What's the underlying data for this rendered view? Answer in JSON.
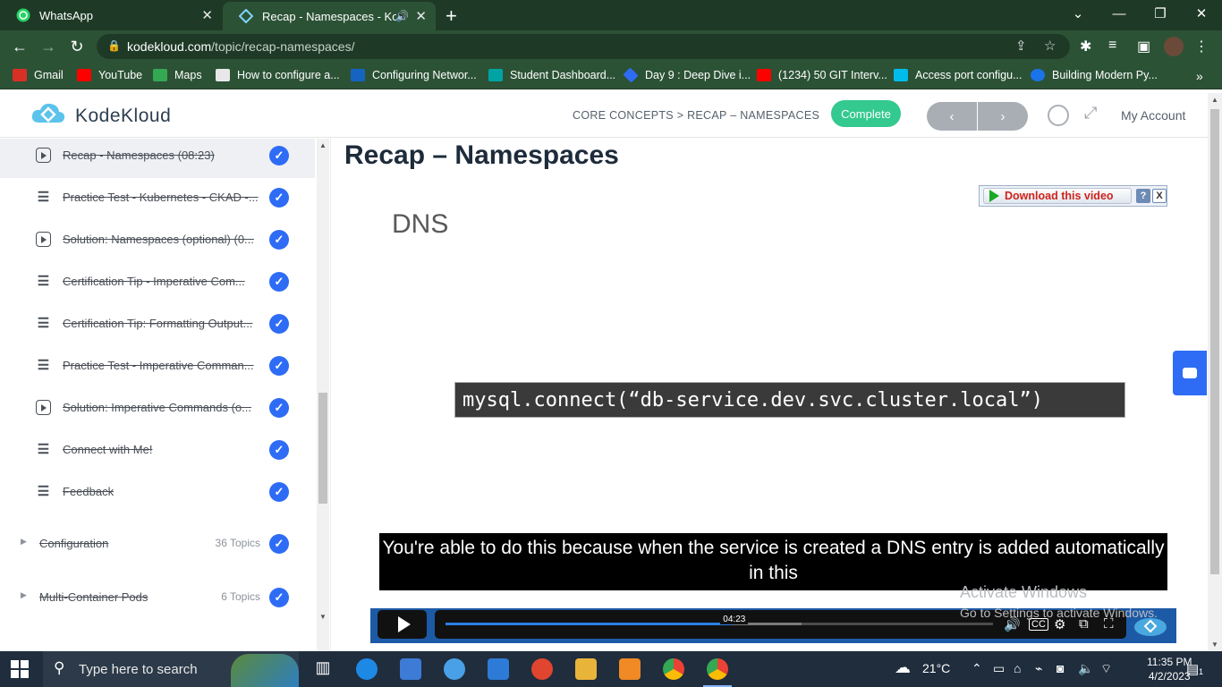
{
  "browser": {
    "tabs": [
      {
        "title": "WhatsApp",
        "icon": "whatsapp-icon"
      },
      {
        "title": "Recap - Namespaces - KodeKloud",
        "icon": "kodekloud-icon"
      }
    ],
    "url_host": "kodekloud.com",
    "url_path": "/topic/recap-namespaces/",
    "bookmarks": [
      {
        "label": "Gmail",
        "icon": "gmail-icon",
        "color": "#d93025"
      },
      {
        "label": "YouTube",
        "icon": "youtube-icon",
        "color": "#ff0000"
      },
      {
        "label": "Maps",
        "icon": "maps-icon",
        "color": "#34a853"
      },
      {
        "label": "How to configure a...",
        "icon": "page-icon",
        "color": "#e8e8e8"
      },
      {
        "label": "Configuring Networ...",
        "icon": "vmware-icon",
        "color": "#1565c0"
      },
      {
        "label": "Student Dashboard...",
        "icon": "dashboard-icon",
        "color": "#00a3a3"
      },
      {
        "label": "Day 9 : Deep Dive i...",
        "icon": "diamond-icon",
        "color": "#2e6cf6"
      },
      {
        "label": "(1234) 50 GIT Interv...",
        "icon": "youtube-icon",
        "color": "#ff0000"
      },
      {
        "label": "Access port configu...",
        "icon": "cisco-icon",
        "color": "#00bceb"
      },
      {
        "label": "Building Modern Py...",
        "icon": "c-icon",
        "color": "#1a73e8"
      }
    ]
  },
  "header": {
    "logo": "KodeKloud",
    "breadcrumb": "CORE CONCEPTS > RECAP – NAMESPACES",
    "complete_label": "Complete",
    "prev_label": "‹",
    "next_label": "›",
    "account_label": "My Account"
  },
  "sidebar": {
    "lessons": [
      {
        "title": "Recap - Namespaces (08:23)",
        "type": "video",
        "active": true
      },
      {
        "title": "Practice Test - Kubernetes - CKAD -...",
        "type": "text",
        "active": false
      },
      {
        "title": "Solution: Namespaces (optional) (0...",
        "type": "video",
        "active": false
      },
      {
        "title": "Certification Tip - Imperative Com...",
        "type": "text",
        "active": false
      },
      {
        "title": "Certification Tip: Formatting Output...",
        "type": "text",
        "active": false
      },
      {
        "title": "Practice Test - Imperative Comman...",
        "type": "text",
        "active": false
      },
      {
        "title": "Solution: Imperative Commands (o...",
        "type": "video",
        "active": false
      },
      {
        "title": "Connect with Me!",
        "type": "text",
        "active": false
      },
      {
        "title": "Feedback",
        "type": "text",
        "active": false
      }
    ],
    "sections": [
      {
        "title": "Configuration",
        "count": "36 Topics"
      },
      {
        "title": "Multi-Container Pods",
        "count": "6 Topics"
      }
    ]
  },
  "main": {
    "title": "Recap – Namespaces",
    "slide_heading": "DNS",
    "code": "mysql.connect(“db-service.dev.svc.cluster.local”)",
    "download_label": "Download this video",
    "download_help": "?",
    "download_close": "X",
    "caption": "You're able to do this because when the service is created a DNS entry is added automatically in this",
    "current_time": "04:23",
    "progress": 0.525,
    "buffered": 0.65,
    "watermark_line1": "Activate Windows",
    "watermark_line2": "Go to Settings to activate Windows."
  },
  "taskbar": {
    "search_placeholder": "Type here to search",
    "temperature": "21°C",
    "time": "11:35 PM",
    "date": "4/2/2023",
    "notifications": "1"
  },
  "colors": {
    "accent": "#2e6cf6",
    "complete": "#34c98e",
    "chrome_dark": "#1e3a26",
    "chrome": "#2c5236"
  }
}
